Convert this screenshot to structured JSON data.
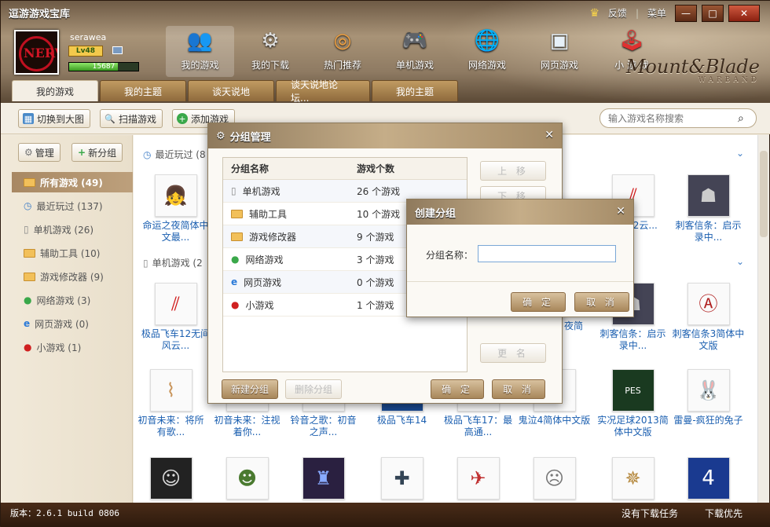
{
  "app": {
    "title": "逗游游戏宝库",
    "feedback": "反馈",
    "menu": "菜单"
  },
  "user": {
    "name": "serawea",
    "level": "Lv48",
    "xp": "15687",
    "xp_fill": 0.7
  },
  "nav": [
    {
      "label": "我的游戏",
      "icon": "users-globe-icon"
    },
    {
      "label": "我的下载",
      "icon": "gear-download-icon"
    },
    {
      "label": "热门推荐",
      "icon": "disc-plus-icon"
    },
    {
      "label": "单机游戏",
      "icon": "gamepad-icon"
    },
    {
      "label": "网络游戏",
      "icon": "globe-icon"
    },
    {
      "label": "网页游戏",
      "icon": "web-page-icon"
    },
    {
      "label": "小 游 戏",
      "icon": "joystick-icon"
    }
  ],
  "logo": {
    "main": "Mount&Blade",
    "sub": "WARBAND"
  },
  "tabs": [
    "我的游戏",
    "我的主题",
    "谈天说地",
    "谈天说地论坛...",
    "我的主题"
  ],
  "toolbar": {
    "bigview": "切换到大图",
    "scan": "扫描游戏",
    "add": "添加游戏",
    "search_placeholder": "输入游戏名称搜索"
  },
  "sidebar": {
    "manage": "管理",
    "new_group": "新分组",
    "items": [
      {
        "label": "所有游戏 (49)"
      },
      {
        "label": "最近玩过 (137)"
      },
      {
        "label": "单机游戏 (26)"
      },
      {
        "label": "辅助工具 (10)"
      },
      {
        "label": "游戏修改器 (9)"
      },
      {
        "label": "网络游戏 (3)"
      },
      {
        "label": "网页游戏 (0)"
      },
      {
        "label": "小游戏 (1)"
      }
    ]
  },
  "content": {
    "recent_header": "最近玩过 (8",
    "single_header": "单机游戏 (2",
    "games_row1": [
      {
        "label": "命运之夜简体中文最..."
      },
      {
        "label": "飞车12云..."
      },
      {
        "label": "刺客信条：启示录中..."
      }
    ],
    "games_row2": [
      {
        "label": "极品飞车12无间风云..."
      },
      {
        "label": "夜简"
      },
      {
        "label": "刺客信条：启示录中..."
      },
      {
        "label": "刺客信条3简体中文版"
      }
    ],
    "games_row3": [
      {
        "label": "初音未来：将所有歌..."
      },
      {
        "label": "初音未来：注视着你..."
      },
      {
        "label": "铃音之歌：初音之声..."
      },
      {
        "label": "极品飞车14"
      },
      {
        "label": "极品飞车17：最高通..."
      },
      {
        "label": "鬼泣4简体中文版"
      },
      {
        "label": "实况足球2013简体中文版"
      },
      {
        "label": "雷曼-疯狂的兔子"
      }
    ]
  },
  "group_dialog": {
    "title": "分组管理",
    "col_name": "分组名称",
    "col_count": "游戏个数",
    "rows": [
      {
        "name": "单机游戏",
        "count": "26 个游戏"
      },
      {
        "name": "辅助工具",
        "count": "10 个游戏"
      },
      {
        "name": "游戏修改器",
        "count": "9 个游戏"
      },
      {
        "name": "网络游戏",
        "count": "3 个游戏"
      },
      {
        "name": "网页游戏",
        "count": "0 个游戏"
      },
      {
        "name": "小游戏",
        "count": "1 个游戏"
      }
    ],
    "move_up": "上 移",
    "move_down": "下 移",
    "rename": "更 名",
    "new_group": "新建分组",
    "delete_group": "删除分组",
    "ok": "确 定",
    "cancel": "取 消"
  },
  "create_dialog": {
    "title": "创建分组",
    "label": "分组名称：",
    "value": "",
    "ok": "确 定",
    "cancel": "取 消"
  },
  "status": {
    "version": "版本：2.6.1 build 0806",
    "no_task": "没有下载任务",
    "priority": "下载优先"
  }
}
